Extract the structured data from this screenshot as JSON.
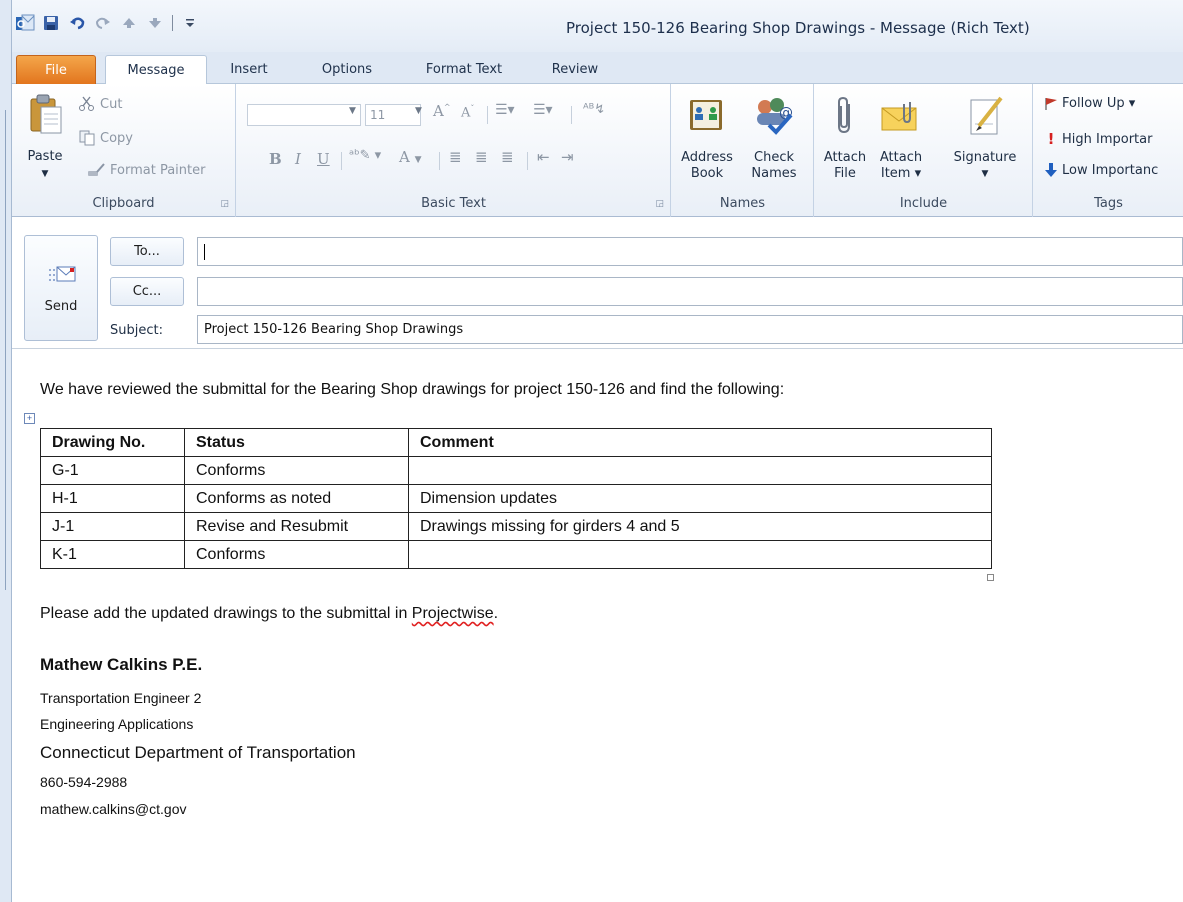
{
  "window": {
    "title": "Project 150-126 Bearing Shop Drawings  -  Message (Rich Text)"
  },
  "quick_access": {
    "icons": [
      "outlook-logo-icon",
      "save-icon",
      "undo-icon",
      "redo-icon",
      "up-arrow-icon",
      "down-arrow-icon",
      "customize-icon"
    ]
  },
  "tabs": [
    "File",
    "Message",
    "Insert",
    "Options",
    "Format Text",
    "Review"
  ],
  "ribbon": {
    "clipboard": {
      "label": "Clipboard",
      "paste": "Paste",
      "cut": "Cut",
      "copy": "Copy",
      "format_painter": "Format Painter"
    },
    "basic_text": {
      "label": "Basic Text",
      "font_name": "",
      "font_size": "11",
      "bold": "B",
      "italic": "I",
      "underline": "U"
    },
    "names": {
      "label": "Names",
      "address_book_1": "Address",
      "address_book_2": "Book",
      "check_names_1": "Check",
      "check_names_2": "Names"
    },
    "include": {
      "label": "Include",
      "attach_file_1": "Attach",
      "attach_file_2": "File",
      "attach_item_1": "Attach",
      "attach_item_2": "Item ▾",
      "signature": "Signature"
    },
    "tags": {
      "label": "Tags",
      "follow_up": "Follow Up ▾",
      "high_importance": "High Importar",
      "low_importance": "Low Importanc"
    }
  },
  "header": {
    "send_label": "Send",
    "to_button": "To...",
    "cc_button": "Cc...",
    "subject_label": "Subject:",
    "to_value": "",
    "cc_value": "",
    "subject_value": "Project 150-126 Bearing Shop Drawings"
  },
  "message": {
    "intro": "We have reviewed the submittal for the Bearing Shop drawings for project 150-126 and find the following:",
    "table": {
      "headers": [
        "Drawing No.",
        "Status",
        "Comment"
      ],
      "rows": [
        [
          "G-1",
          "Conforms",
          ""
        ],
        [
          "H-1",
          "Conforms as noted",
          "Dimension updates"
        ],
        [
          "J-1",
          "Revise and Resubmit",
          "Drawings missing for girders 4 and 5"
        ],
        [
          "K-1",
          "Conforms",
          ""
        ]
      ]
    },
    "request_before": "Please add the updated drawings to the submittal in ",
    "request_word": "Projectwise",
    "request_after": "."
  },
  "signature": {
    "name": "Mathew Calkins P.E.",
    "title": "Transportation Engineer 2",
    "unit": "Engineering Applications",
    "department": "Connecticut Department of Transportation",
    "phone": "860-594-2988",
    "email": "mathew.calkins@ct.gov"
  },
  "colors": {
    "file_tab": "#e2751e",
    "ribbon_bg": "#e9eff7",
    "accent_blue": "#2a5699",
    "follow_up_flag": "#c0392b",
    "high_importance": "#d62020",
    "low_importance": "#1f5fbf"
  }
}
